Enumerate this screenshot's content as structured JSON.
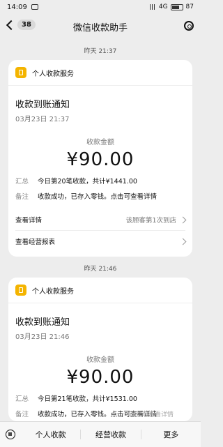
{
  "status": {
    "time": "14:09",
    "right_text": "4G",
    "battery": "87"
  },
  "nav": {
    "badge": "38",
    "title": "微信收款助手"
  },
  "messages": [
    {
      "time_label": "昨天 21:37",
      "service": "个人收款服务",
      "title": "收款到账通知",
      "date": "03月23日 21:37",
      "amount_label": "收款金额",
      "amount": "¥90.00",
      "summary_k": "汇总",
      "summary_v": "今日第20笔收款，共计¥1441.00",
      "note_k": "备注",
      "note_v": "收款成功，已存入零钱。点击可查看详情",
      "view_details": "查看详情",
      "view_details_right": "该顾客第1次到店",
      "view_reports": "查看经营报表"
    },
    {
      "time_label": "昨天 21:46",
      "service": "个人收款服务",
      "title": "收款到账通知",
      "date": "03月23日 21:46",
      "amount_label": "收款金额",
      "amount": "¥90.00",
      "summary_k": "汇总",
      "summary_v": "今日第21笔收款，共计¥1531.00",
      "note_k": "备注",
      "note_v": "收款成功，已存入零钱。点击可查看详情"
    }
  ],
  "bottom": {
    "tabs": [
      "个人收款",
      "经营收款",
      "更多"
    ],
    "overlay": "前往可查看详情"
  }
}
